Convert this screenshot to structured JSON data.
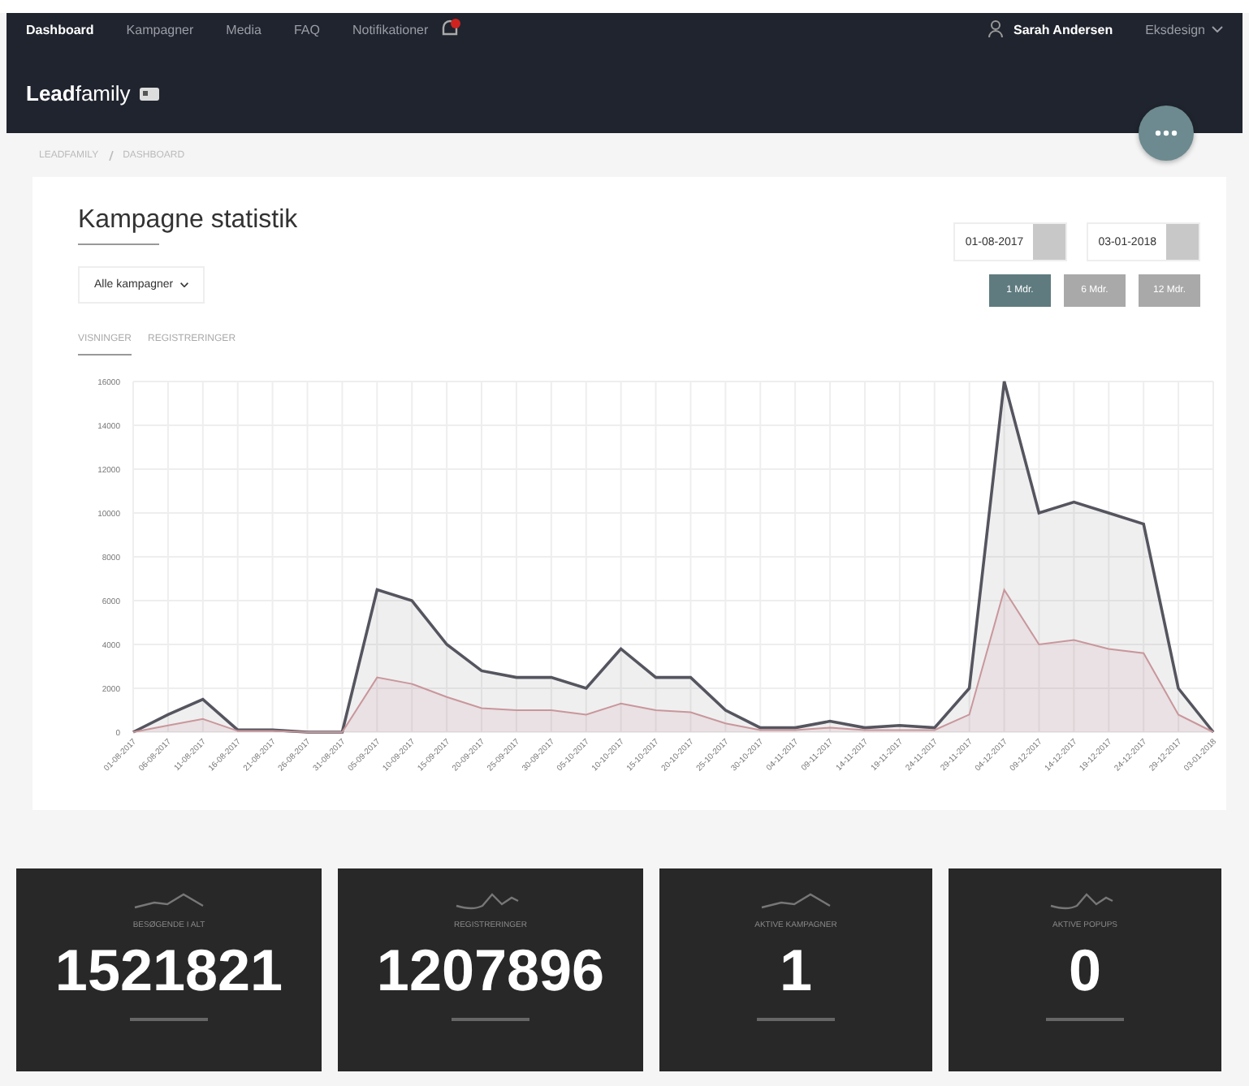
{
  "nav": {
    "items": [
      {
        "label": "Dashboard",
        "selected": true
      },
      {
        "label": "Kampagner",
        "selected": false
      },
      {
        "label": "Media",
        "selected": false
      },
      {
        "label": "FAQ",
        "selected": false
      },
      {
        "label": "Notifikationer",
        "selected": false
      }
    ],
    "user": "Sarah Andersen",
    "account": "Eksdesign"
  },
  "brand": {
    "bold": "Lead",
    "light": "family"
  },
  "breadcrumb": [
    "LEADFAMILY",
    "DASHBOARD"
  ],
  "card": {
    "title": "Kampagne statistik",
    "filter": "Alle kampagner",
    "date_from": "01-08-2017",
    "date_to": "03-01-2018",
    "ranges": [
      {
        "label": "1 Mdr.",
        "selected": true
      },
      {
        "label": "6 Mdr.",
        "selected": false
      },
      {
        "label": "12 Mdr.",
        "selected": false
      }
    ],
    "tabs": [
      {
        "label": "VISNINGER",
        "selected": true
      },
      {
        "label": "REGISTRERINGER",
        "selected": false
      }
    ],
    "chart_data": {
      "type": "area",
      "grid": true,
      "x": [
        "01-08-2017",
        "06-08-2017",
        "11-08-2017",
        "16-08-2017",
        "21-08-2017",
        "26-08-2017",
        "31-08-2017",
        "05-09-2017",
        "10-09-2017",
        "15-09-2017",
        "20-09-2017",
        "25-09-2017",
        "30-09-2017",
        "05-10-2017",
        "10-10-2017",
        "15-10-2017",
        "20-10-2017",
        "25-10-2017",
        "30-10-2017",
        "04-11-2017",
        "09-11-2017",
        "14-11-2017",
        "19-11-2017",
        "24-11-2017",
        "29-11-2017",
        "04-12-2017",
        "09-12-2017",
        "14-12-2017",
        "19-12-2017",
        "24-12-2017",
        "29-12-2017",
        "03-01-2018"
      ],
      "ylim": [
        0,
        16000
      ],
      "yticks": [
        0,
        2000,
        4000,
        6000,
        8000,
        10000,
        12000,
        14000,
        16000
      ],
      "series": [
        {
          "color": "#55555f",
          "values": [
            0,
            800,
            1500,
            100,
            100,
            0,
            0,
            6500,
            6000,
            4000,
            2800,
            2500,
            2500,
            2000,
            3800,
            2500,
            2500,
            1000,
            200,
            200,
            500,
            200,
            300,
            200,
            2000,
            16000,
            10000,
            10500,
            10000,
            9500,
            2000,
            0
          ]
        },
        {
          "color": "#c9969b",
          "values": [
            0,
            300,
            600,
            50,
            50,
            0,
            0,
            2500,
            2200,
            1600,
            1100,
            1000,
            1000,
            800,
            1300,
            1000,
            900,
            400,
            100,
            100,
            200,
            100,
            100,
            100,
            800,
            6500,
            4000,
            4200,
            3800,
            3600,
            800,
            0
          ]
        }
      ]
    }
  },
  "stats": [
    {
      "label": "BESØGENDE I ALT",
      "value": "1521821"
    },
    {
      "label": "REGISTRERINGER",
      "value": "1207896"
    },
    {
      "label": "AKTIVE KAMPAGNER",
      "value": "1"
    },
    {
      "label": "AKTIVE POPUPS",
      "value": "0"
    }
  ]
}
